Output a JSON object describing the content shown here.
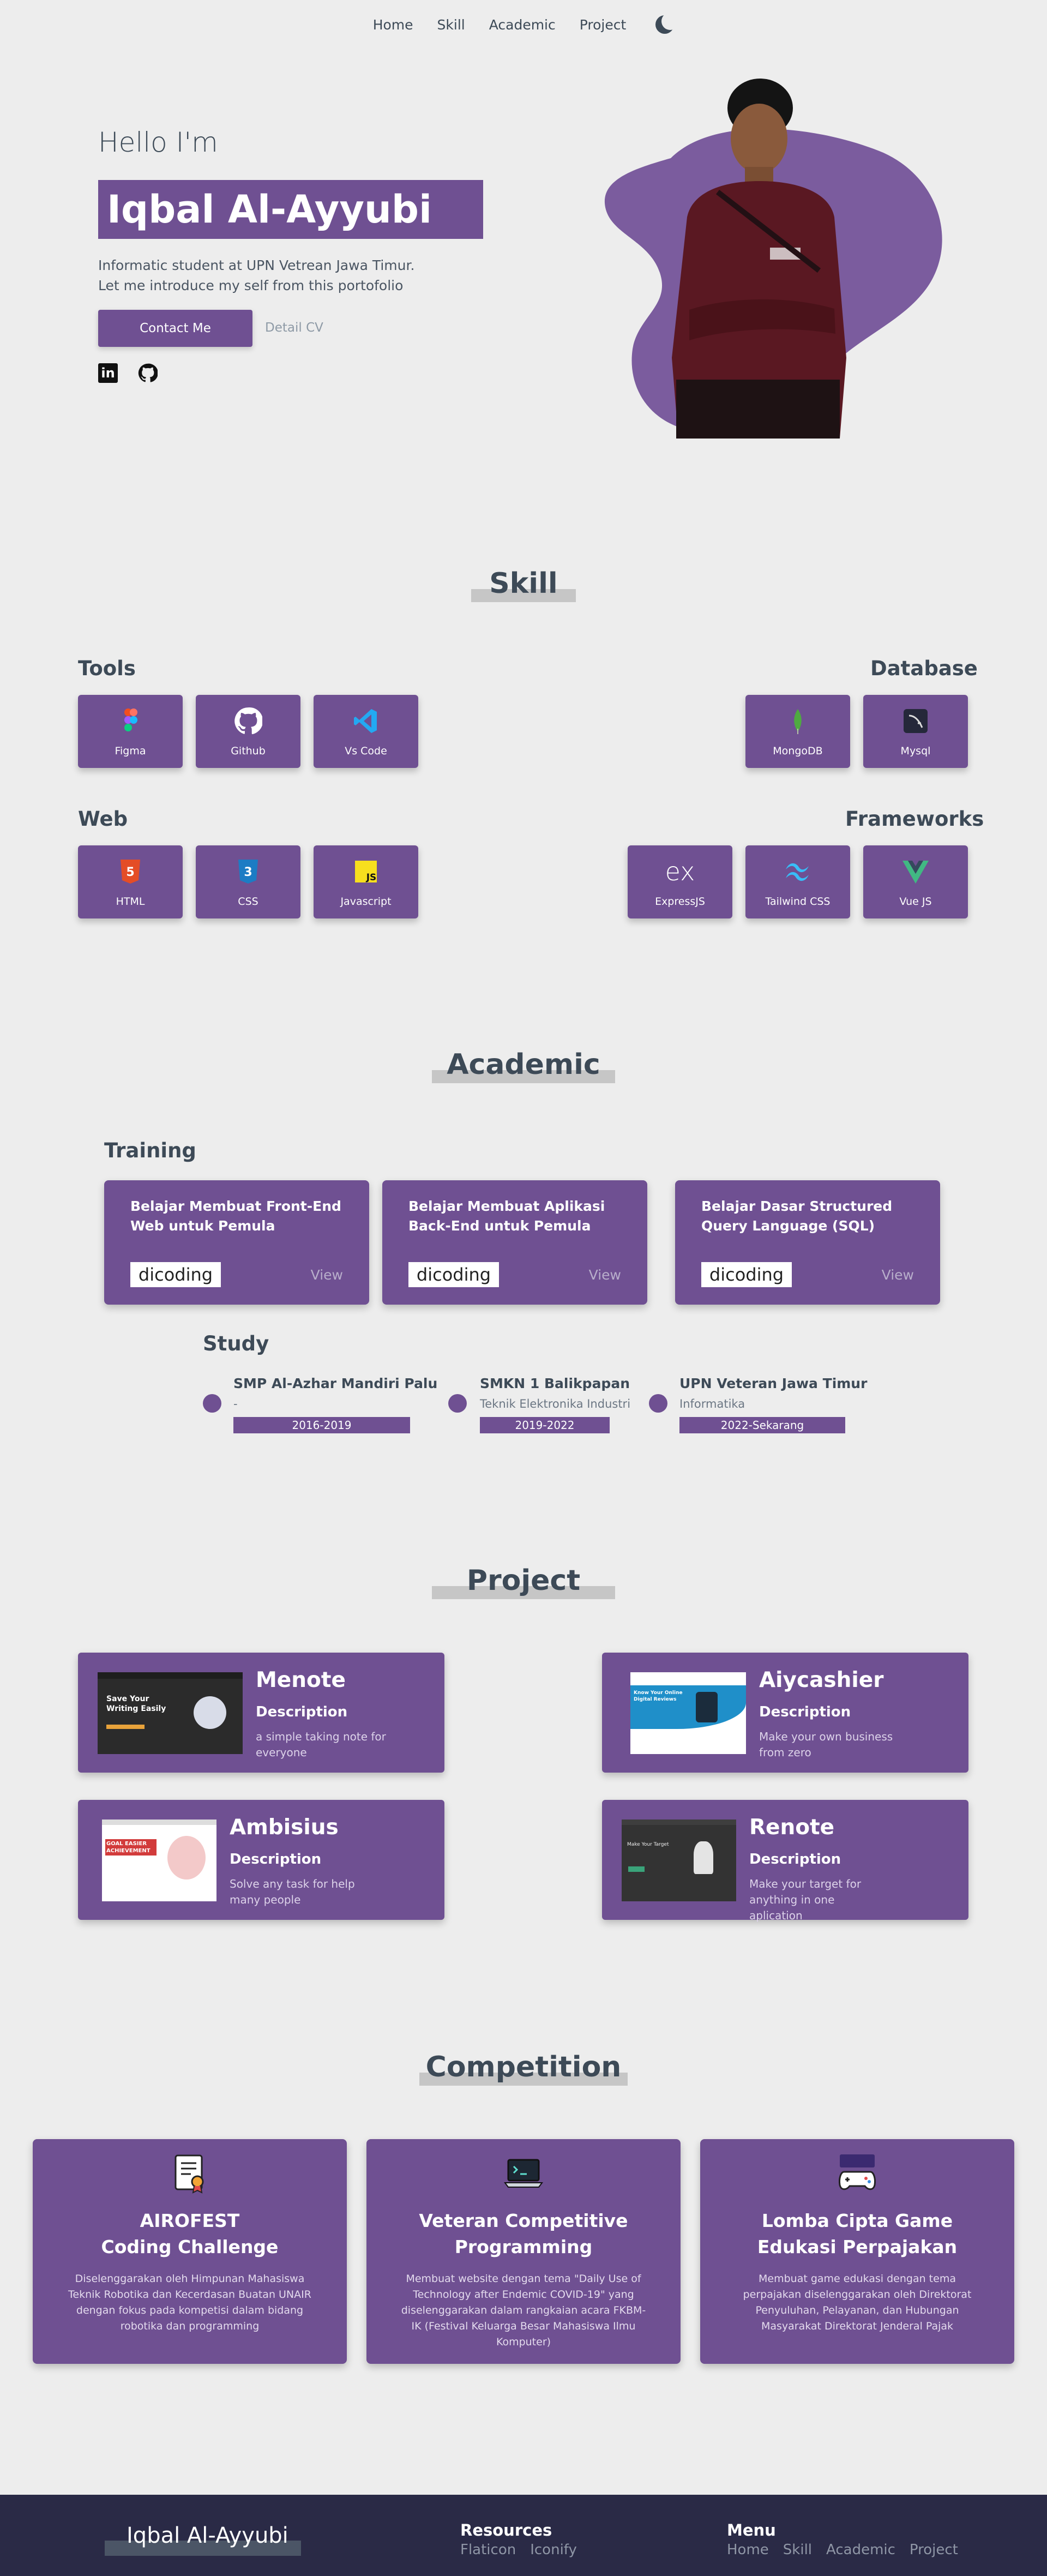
{
  "nav": {
    "items": [
      "Home",
      "Skill",
      "Academic",
      "Project"
    ],
    "theme_icon": "moon-icon"
  },
  "hero": {
    "greeting": "Hello I'm",
    "name": "Iqbal Al-Ayyubi",
    "intro_line1": "Informatic student at UPN Vetrean Jawa Timur.",
    "intro_line2": "Let me introduce my self from this portofolio",
    "contact_button": "Contact Me",
    "cv_link": "Detail CV",
    "social_icons": [
      "linkedin-icon",
      "github-icon"
    ],
    "accent": "#6f5092"
  },
  "skill": {
    "title": "Skill",
    "groups": {
      "tools": {
        "label": "Tools",
        "items": [
          "Figma",
          "Github",
          "Vs Code"
        ]
      },
      "database": {
        "label": "Database",
        "items": [
          "MongoDB",
          "Mysql"
        ]
      },
      "web": {
        "label": "Web",
        "items": [
          "HTML",
          "CSS",
          "Javascript"
        ]
      },
      "frameworks": {
        "label": "Frameworks",
        "items": [
          "ExpressJS",
          "Tailwind CSS",
          "Vue JS"
        ]
      }
    }
  },
  "academic": {
    "title": "Academic",
    "training_label": "Training",
    "training": [
      {
        "title": "Belajar Membuat Front-End Web untuk Pemula",
        "provider": "dicoding",
        "action": "View"
      },
      {
        "title": "Belajar Membuat Aplikasi Back-End untuk Pemula",
        "provider": "dicoding",
        "action": "View"
      },
      {
        "title": "Belajar Dasar Structured Query Language (SQL)",
        "provider": "dicoding",
        "action": "View"
      }
    ],
    "study_label": "Study",
    "study": [
      {
        "school": "SMP Al-Azhar Mandiri Palu",
        "major": "-",
        "years": "2016-2019"
      },
      {
        "school": "SMKN 1 Balikpapan",
        "major": "Teknik Elektronika Industri",
        "years": "2019-2022"
      },
      {
        "school": "UPN Veteran Jawa Timur",
        "major": "Informatika",
        "years": "2022-Sekarang"
      }
    ]
  },
  "project": {
    "title": "Project",
    "items": [
      {
        "name": "Menote",
        "desc_label": "Description",
        "desc": "a simple taking note for everyone",
        "shot_text": "Save Your Writing Easily"
      },
      {
        "name": "Aiycashier",
        "desc_label": "Description",
        "desc": "Make your own business from zero",
        "shot_text": "Know Your Online Digital Reviews"
      },
      {
        "name": "Ambisius",
        "desc_label": "Description",
        "desc": "Solve any task for help many people",
        "shot_text": "GOAL EASIER ACHIEVEMENT"
      },
      {
        "name": "Renote",
        "desc_label": "Description",
        "desc": "Make your target for anything in one aplication",
        "shot_text": "Make Your Target"
      }
    ]
  },
  "competition": {
    "title": "Competition",
    "items": [
      {
        "title_line1": "AIROFEST",
        "title_line2": "Coding Challenge",
        "desc": "Diselenggarakan oleh Himpunan Mahasiswa Teknik Robotika dan Kecerdasan Buatan UNAIR dengan fokus pada kompetisi dalam bidang robotika dan programming",
        "icon": "certificate-icon"
      },
      {
        "title_line1": "Veteran Competitive",
        "title_line2": "Programming",
        "desc": "Membuat website dengan tema \"Daily Use of Technology after Endemic COVID-19\" yang diselenggarakan dalam rangkaian acara FKBM-IK (Festival Keluarga Besar Mahasiswa Ilmu Komputer)",
        "icon": "laptop-code-icon"
      },
      {
        "title_line1": "Lomba Cipta Game",
        "title_line2": "Edukasi Perpajakan",
        "desc": "Membuat game edukasi dengan tema perpajakan diselenggarakan oleh Direktorat Penyuluhan, Pelayanan, dan Hubungan Masyarakat Direktorat Jenderal Pajak",
        "icon": "gamepad-icon"
      }
    ]
  },
  "footer": {
    "name": "Iqbal Al-Ayyubi",
    "resources_label": "Resources",
    "resources": [
      "Flaticon",
      "Iconify"
    ],
    "menu_label": "Menu",
    "menu": [
      "Home",
      "Skill",
      "Academic",
      "Project"
    ]
  }
}
